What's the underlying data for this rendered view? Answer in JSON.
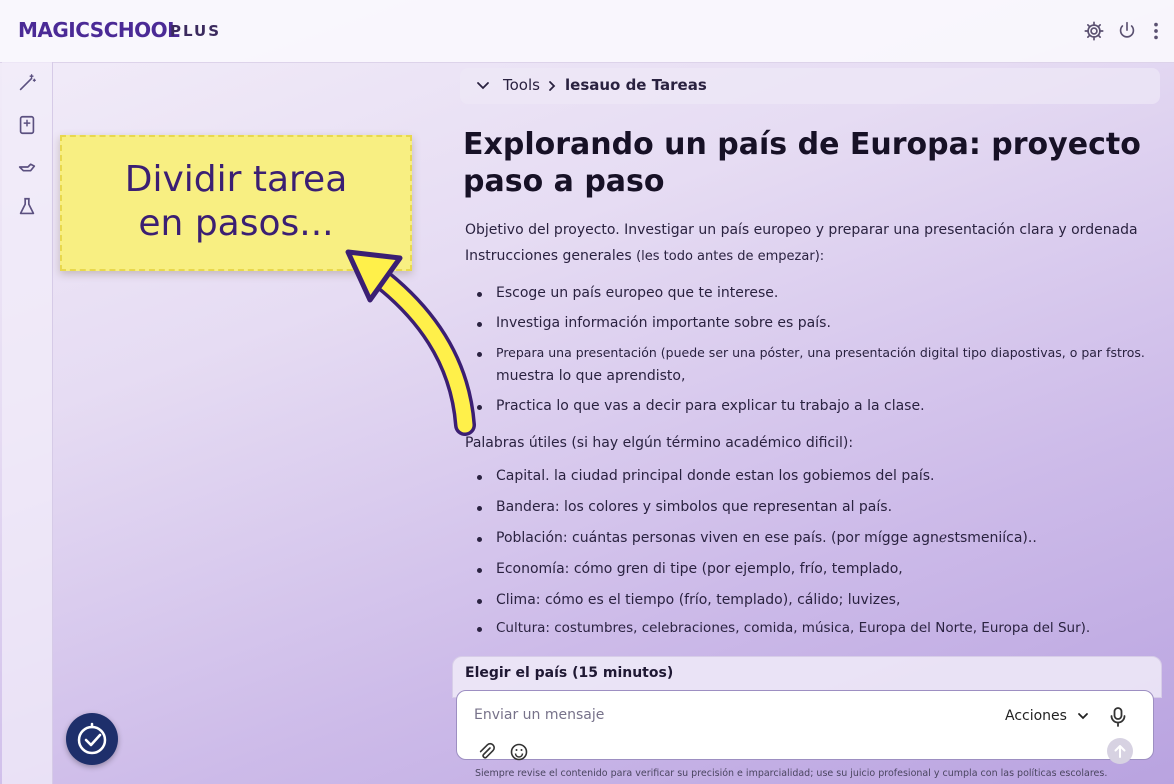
{
  "header": {
    "logo_text": "MAGICSCHOOL",
    "logo_suffix": "PLUS",
    "icons": [
      "gear-icon",
      "power-icon",
      "more-vertical-icon"
    ]
  },
  "sidebar": {
    "icons": [
      "magic-wand-icon",
      "document-icon",
      "hand-icon",
      "flask-icon"
    ],
    "bottom_button_icon": "checklist-clock-icon"
  },
  "callout": {
    "line1": "Dividir tarea",
    "line2": "en pasos..."
  },
  "breadcrumb": {
    "parent": "Tools",
    "current": "lesauo de Tareas"
  },
  "document": {
    "title_line1": "Explorando un país de Europa: proyecto",
    "title_line2": "paso a paso",
    "objective": "Objetivo del proyecto. Investigar un país europeo y preparar una presentación clara y ordenada",
    "instructions_heading": "Instrucciones generales",
    "instructions_note": "(les todo antes de empezar):",
    "instructions": [
      "Escoge un país europeo que te interese.",
      "Investiga información importante sobre es país.",
      "Prepara una presentación (puede ser una póster, una presentación digital tipo diapostivas, o par fstros.",
      "muestra lo que aprendisto,",
      "Practica lo que vas a decir para explicar tu trabajo a la clase."
    ],
    "words_heading": "Palabras útiles (si hay elgún término académico dificil):",
    "words": [
      "Capital. la ciudad principal donde estan los gobiemos del país.",
      "Bandera: los colores y simbolos que representan al país.",
      "Población: cuántas personas viven en ese país. (por mígge agnℯstsmeniíca)..",
      "Economía: cómo gren di tipe (por ejemplo, frío, templado,",
      "Clima: cómo es el tiempo (frío, templado), cálido; luvizes,",
      "Cultura: costumbres, celebraciones, comida, música, Europa del Norte, Europa del Sur)."
    ]
  },
  "step": {
    "label": "Elegir el país (15 minutos)"
  },
  "composer": {
    "placeholder": "Enviar un mensaje",
    "actions_label": "Acciones"
  },
  "footer": {
    "disclaimer": "Siempre revise el contenido para verificar su precisión e imparcialidad; use su juicio profesional y cumpla con las políticas escolares."
  }
}
